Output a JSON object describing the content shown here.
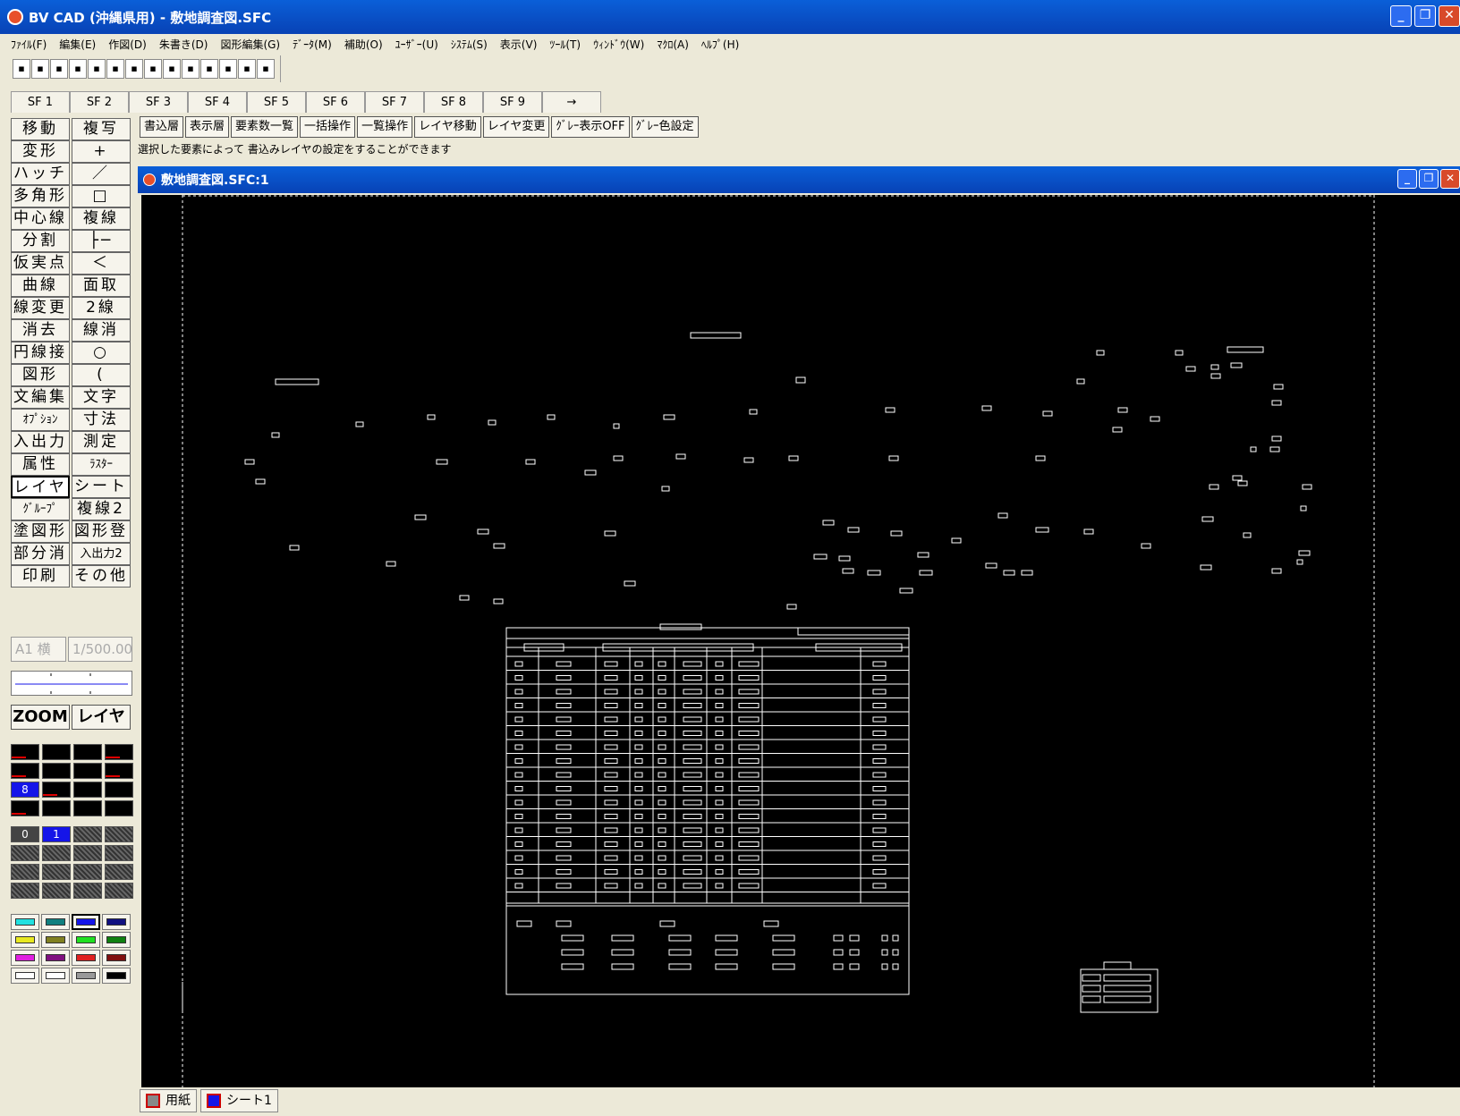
{
  "window": {
    "title": "BV CAD (沖縄県用) - 敷地調査図.SFC",
    "controls": [
      "_",
      "❐",
      "✕"
    ]
  },
  "menu": [
    "ﾌｧｲﾙ(F)",
    "編集(E)",
    "作図(D)",
    "朱書き(D)",
    "図形編集(G)",
    "ﾃﾞｰﾀ(M)",
    "補助(O)",
    "ﾕｰｻﾞｰ(U)",
    "ｼｽﾃﾑ(S)",
    "表示(V)",
    "ﾂｰﾙ(T)",
    "ｳｨﾝﾄﾞｳ(W)",
    "ﾏｸﾛ(A)",
    "ﾍﾙﾌﾟ(H)"
  ],
  "toolbar_icons": [
    "open-icon",
    "save-icon",
    "new-icon",
    "copy-icon",
    "print-icon",
    "open2-icon",
    "save2-icon",
    "open3-icon",
    "save3-icon",
    "open4-icon",
    "open5-icon",
    "save4-icon",
    "open6-icon",
    "disabled-icon"
  ],
  "sf_keys": [
    "SF 1",
    "SF 2",
    "SF 3",
    "SF 4",
    "SF 5",
    "SF 6",
    "SF 7",
    "SF 8",
    "SF 9",
    "→"
  ],
  "commands": [
    "書込層",
    "表示層",
    "要素数一覧",
    "一括操作",
    "一覧操作",
    "レイヤ移動",
    "レイヤ変更",
    "ｸﾞﾚｰ表示OFF",
    "ｸﾞﾚｰ色設定"
  ],
  "hint": "選択した要素によって 書込みレイヤの設定をすることができます",
  "left_buttons": [
    [
      "移動",
      "複写"
    ],
    [
      "変形",
      "+"
    ],
    [
      "ハッチ",
      "／"
    ],
    [
      "多角形",
      "□"
    ],
    [
      "中心線",
      "複線"
    ],
    [
      "分割",
      "├─"
    ],
    [
      "仮実点",
      "＜"
    ],
    [
      "曲線",
      "面取"
    ],
    [
      "線変更",
      "2線"
    ],
    [
      "消去",
      "線消"
    ],
    [
      "円線接",
      "○"
    ],
    [
      "図形",
      "("
    ],
    [
      "文編集",
      "文字"
    ],
    [
      "ｵﾌﾟｼｮﾝ",
      "寸法"
    ],
    [
      "入出力",
      "測定"
    ],
    [
      "属性",
      "ﾗｽﾀｰ"
    ],
    [
      "レイヤ",
      "シート"
    ],
    [
      "ｸﾞﾙｰﾌﾟ",
      "複線2"
    ],
    [
      "塗図形",
      "図形登"
    ],
    [
      "部分消",
      "入出力2"
    ],
    [
      "印刷",
      "その他"
    ]
  ],
  "paper": {
    "size": "A1 横",
    "scale": "1/500.00"
  },
  "zoom": {
    "zoom_label": "ZOOM",
    "layer_label": "レイヤ"
  },
  "layer_palette_selected": "8",
  "sheet_palette": [
    "0",
    "1"
  ],
  "colors": [
    "#22e0e0",
    "#118080",
    "#1515e8",
    "#101080",
    "#e8e820",
    "#808020",
    "#20e020",
    "#108010",
    "#e020e0",
    "#801080",
    "#e02020",
    "#801010",
    "#ffffff",
    "#ffffff",
    "#999999",
    "#000000"
  ],
  "child_window": {
    "title": "敷地調査図.SFC:1"
  },
  "sheet_tabs": [
    "用紙",
    "シート1"
  ]
}
